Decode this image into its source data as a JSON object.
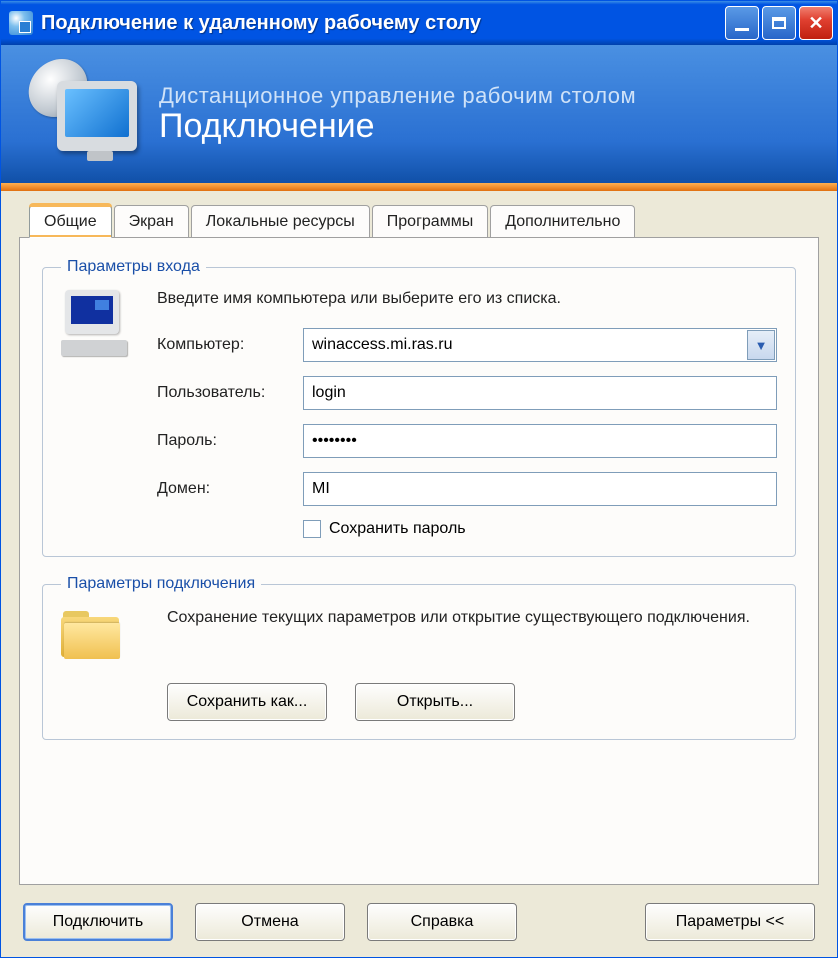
{
  "window": {
    "title": "Подключение к удаленному рабочему столу"
  },
  "banner": {
    "subtitle": "Дистанционное управление рабочим столом",
    "title": "Подключение"
  },
  "tabs": {
    "general": "Общие",
    "display": "Экран",
    "local": "Локальные ресурсы",
    "programs": "Программы",
    "advanced": "Дополнительно"
  },
  "login": {
    "legend": "Параметры входа",
    "intro": "Введите имя компьютера или выберите его из списка.",
    "computer_label": "Компьютер:",
    "computer_value": "winaccess.mi.ras.ru",
    "user_label": "Пользователь:",
    "user_value": "login",
    "password_label": "Пароль:",
    "password_value": "••••••••",
    "domain_label": "Домен:",
    "domain_value": "MI",
    "save_password": "Сохранить пароль"
  },
  "connection": {
    "legend": "Параметры подключения",
    "desc": "Сохранение текущих параметров или открытие существующего подключения.",
    "save_as": "Сохранить как...",
    "open": "Открыть..."
  },
  "footer": {
    "connect": "Подключить",
    "cancel": "Отмена",
    "help": "Справка",
    "params": "Параметры <<"
  }
}
